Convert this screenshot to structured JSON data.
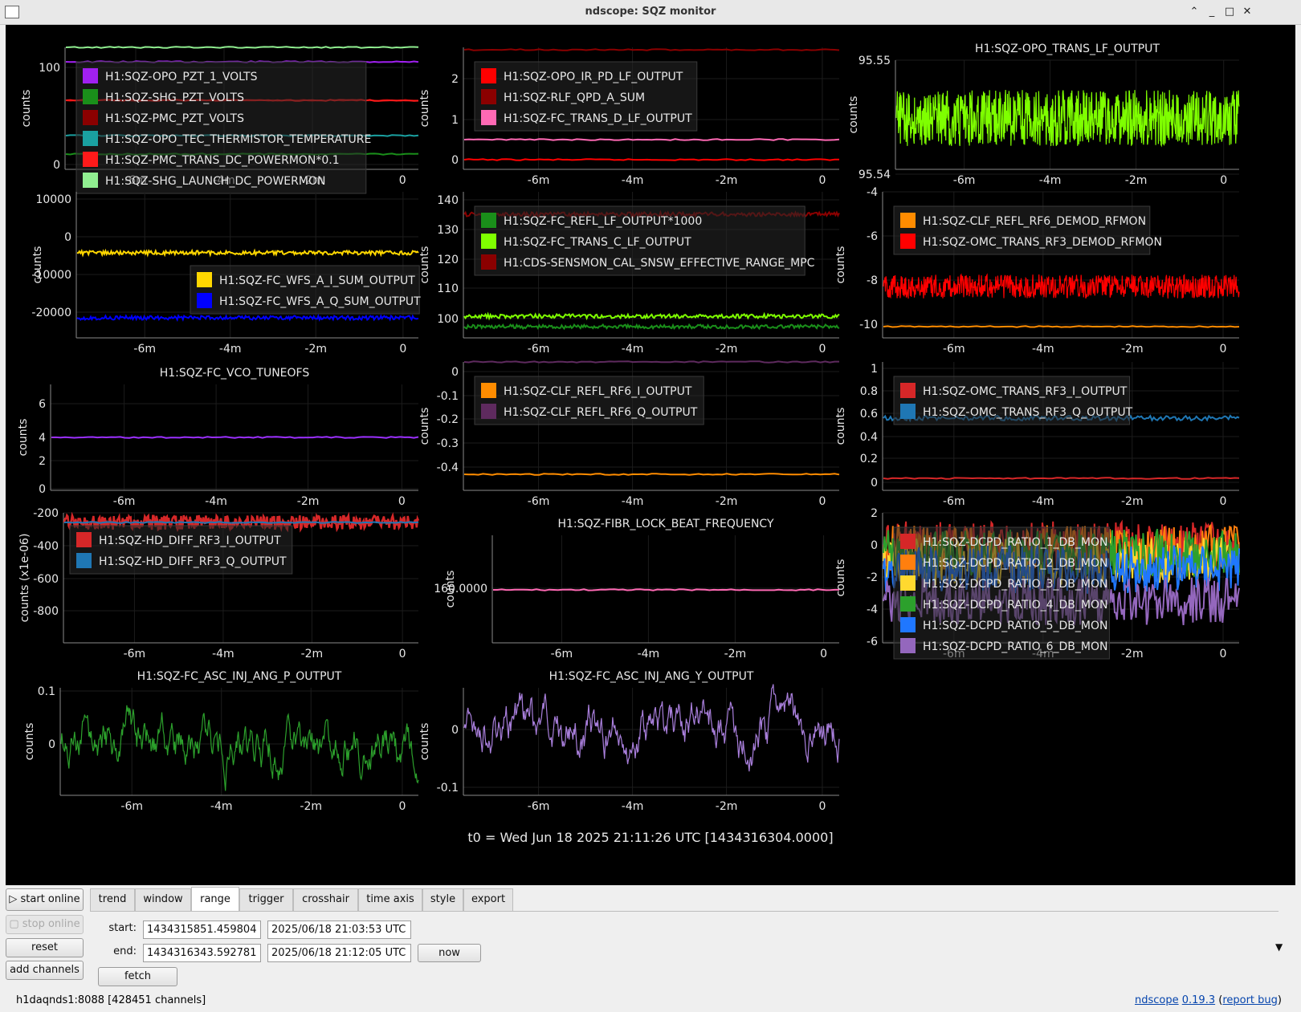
{
  "window": {
    "title": "ndscope: SQZ monitor",
    "controls": {
      "minimize_up": "⌃",
      "minimize": "_",
      "maximize": "□",
      "close": "✕"
    }
  },
  "plot_bg": "#000000",
  "t0_label": "t0 = Wed Jun 18 2025 21:11:26 UTC [1434316304.0000]",
  "chart_data": [
    {
      "type": "line",
      "title": "",
      "ylabel": "counts",
      "xticks": [
        "-6m",
        "-4m",
        "-2m",
        "0"
      ],
      "yticks": [
        "100",
        "0"
      ],
      "series": [
        {
          "name": "H1:SQZ-OPO_PZT_1_VOLTS",
          "color": "#a020f0",
          "y": 100
        },
        {
          "name": "H1:SQZ-SHG_PZT_VOLTS",
          "color": "#1a8f1a",
          "y": 10
        },
        {
          "name": "H1:SQZ-PMC_PZT_VOLTS",
          "color": "#8b0000",
          "y": 62
        },
        {
          "name": "H1:SQZ-OPO_TEC_THERMISTOR_TEMPERATURE",
          "color": "#1aa0a0",
          "y": 28
        },
        {
          "name": "H1:SQZ-PMC_TRANS_DC_POWERMON*0.1",
          "color": "#ff1a1a",
          "y": 62
        },
        {
          "name": "H1:SQZ-SHG_LAUNCH_DC_POWERMON",
          "color": "#90ee90",
          "y": 0
        }
      ]
    },
    {
      "type": "line",
      "title": "",
      "ylabel": "counts",
      "xticks": [
        "-6m",
        "-4m",
        "-2m",
        "0"
      ],
      "yticks": [
        "2",
        "1",
        "0"
      ],
      "series": [
        {
          "name": "H1:SQZ-OPO_IR_PD_LF_OUTPUT",
          "color": "#ff0000",
          "y": 0
        },
        {
          "name": "H1:SQZ-RLF_QPD_A_SUM",
          "color": "#8b0000",
          "y": 2.7
        },
        {
          "name": "H1:SQZ-FC_TRANS_D_LF_OUTPUT",
          "color": "#ff69b4",
          "y": 0.5
        }
      ]
    },
    {
      "type": "line",
      "title": "H1:SQZ-OPO_TRANS_LF_OUTPUT",
      "ylabel": "counts",
      "xticks": [
        "-6m",
        "-4m",
        "-2m",
        "0"
      ],
      "yticks": [
        "95.55",
        "95.54"
      ],
      "series": [
        {
          "name": "",
          "color": "#7fff00",
          "y": 95.545
        }
      ]
    },
    {
      "type": "line",
      "title": "",
      "ylabel": "counts",
      "xticks": [
        "-6m",
        "-4m",
        "-2m",
        "0"
      ],
      "yticks": [
        "10000",
        "0",
        "-10000",
        "-20000"
      ],
      "series": [
        {
          "name": "H1:SQZ-FC_WFS_A_I_SUM_OUTPUT",
          "color": "#ffd700",
          "y": 0
        },
        {
          "name": "H1:SQZ-FC_WFS_A_Q_SUM_OUTPUT",
          "color": "#0000ff",
          "y": -17500
        }
      ]
    },
    {
      "type": "line",
      "title": "",
      "ylabel": "counts",
      "xticks": [
        "-6m",
        "-4m",
        "-2m",
        "0"
      ],
      "yticks": [
        "140",
        "130",
        "120",
        "110",
        "100"
      ],
      "series": [
        {
          "name": "H1:SQZ-FC_REFL_LF_OUTPUT*1000",
          "color": "#1a8f1a",
          "y": 103
        },
        {
          "name": "H1:SQZ-FC_TRANS_C_LF_OUTPUT",
          "color": "#7fff00",
          "y": 106
        },
        {
          "name": "H1:CDS-SENSMON_CAL_SNSW_EFFECTIVE_RANGE_MPC",
          "color": "#8b0000",
          "y": 137
        }
      ]
    },
    {
      "type": "line",
      "title": "",
      "ylabel": "counts",
      "xticks": [
        "-6m",
        "-4m",
        "-2m",
        "0"
      ],
      "yticks": [
        "-4",
        "-6",
        "-8",
        "-10"
      ],
      "series": [
        {
          "name": "H1:SQZ-CLF_REFL_RF6_DEMOD_RFMON",
          "color": "#ff8c00",
          "y": -10.4
        },
        {
          "name": "H1:SQZ-OMC_TRANS_RF3_DEMOD_RFMON",
          "color": "#ff0000",
          "y": -8.5
        }
      ]
    },
    {
      "type": "line",
      "title": "H1:SQZ-FC_VCO_TUNEOFS",
      "ylabel": "counts",
      "xticks": [
        "-6m",
        "-4m",
        "-2m",
        "0"
      ],
      "yticks": [
        "6",
        "4",
        "2",
        "0"
      ],
      "series": [
        {
          "name": "",
          "color": "#9b30ff",
          "y": 3.6
        }
      ]
    },
    {
      "type": "line",
      "title": "",
      "ylabel": "counts",
      "xticks": [
        "-6m",
        "-4m",
        "-2m",
        "0"
      ],
      "yticks": [
        "0",
        "-0.1",
        "-0.2",
        "-0.3",
        "-0.4"
      ],
      "series": [
        {
          "name": "H1:SQZ-CLF_REFL_RF6_I_OUTPUT",
          "color": "#ff8c00",
          "y": -0.45
        },
        {
          "name": "H1:SQZ-CLF_REFL_RF6_Q_OUTPUT",
          "color": "#5e2a5e",
          "y": 0
        }
      ]
    },
    {
      "type": "line",
      "title": "",
      "ylabel": "counts",
      "xticks": [
        "-6m",
        "-4m",
        "-2m",
        "0"
      ],
      "yticks": [
        "1",
        "0.8",
        "0.6",
        "0.4",
        "0.2",
        "0"
      ],
      "series": [
        {
          "name": "H1:SQZ-OMC_TRANS_RF3_I_OUTPUT",
          "color": "#d62728",
          "y": 0.05
        },
        {
          "name": "H1:SQZ-OMC_TRANS_RF3_Q_OUTPUT",
          "color": "#1f77b4",
          "y": 0.62
        }
      ]
    },
    {
      "type": "line",
      "title": "",
      "ylabel": "counts (x1e-06)",
      "xticks": [
        "-6m",
        "-4m",
        "-2m",
        "0"
      ],
      "yticks": [
        "-200",
        "-400",
        "-600",
        "-800"
      ],
      "series": [
        {
          "name": "H1:SQZ-HD_DIFF_RF3_I_OUTPUT",
          "color": "#d62728",
          "y": -220
        },
        {
          "name": "H1:SQZ-HD_DIFF_RF3_Q_OUTPUT",
          "color": "#1f77b4",
          "y": -220
        }
      ]
    },
    {
      "type": "line",
      "title": "H1:SQZ-FIBR_LOCK_BEAT_FREQUENCY",
      "ylabel": "counts",
      "xticks": [
        "-6m",
        "-4m",
        "-2m",
        "0"
      ],
      "yticks": [
        "160.0000"
      ],
      "series": [
        {
          "name": "",
          "color": "#ff69b4",
          "y": 160
        }
      ]
    },
    {
      "type": "line",
      "title": "",
      "ylabel": "counts",
      "xticks": [
        "-6m",
        "-4m",
        "-2m",
        "0"
      ],
      "yticks": [
        "2",
        "0",
        "-2",
        "-4",
        "-6"
      ],
      "series": [
        {
          "name": "H1:SQZ-DCPD_RATIO_1_DB_MON",
          "color": "#d62728",
          "y": 1
        },
        {
          "name": "H1:SQZ-DCPD_RATIO_2_DB_MON",
          "color": "#ff7f0e",
          "y": 1.5
        },
        {
          "name": "H1:SQZ-DCPD_RATIO_3_DB_MON",
          "color": "#ffd92f",
          "y": -1
        },
        {
          "name": "H1:SQZ-DCPD_RATIO_4_DB_MON",
          "color": "#2ca02c",
          "y": 0
        },
        {
          "name": "H1:SQZ-DCPD_RATIO_5_DB_MON",
          "color": "#1f77ff",
          "y": -2
        },
        {
          "name": "H1:SQZ-DCPD_RATIO_6_DB_MON",
          "color": "#9467bd",
          "y": -3.5
        }
      ]
    },
    {
      "type": "line",
      "title": "H1:SQZ-FC_ASC_INJ_ANG_P_OUTPUT",
      "ylabel": "counts",
      "xticks": [
        "-6m",
        "-4m",
        "-2m",
        "0"
      ],
      "yticks": [
        "0.1",
        "0"
      ],
      "series": [
        {
          "name": "",
          "color": "#2ca02c",
          "y": 0
        }
      ]
    },
    {
      "type": "line",
      "title": "H1:SQZ-FC_ASC_INJ_ANG_Y_OUTPUT",
      "ylabel": "counts",
      "xticks": [
        "-6m",
        "-4m",
        "-2m",
        "0"
      ],
      "yticks": [
        "0",
        "-0.1"
      ],
      "series": [
        {
          "name": "",
          "color": "#a97fdc",
          "y": 0
        }
      ]
    }
  ],
  "tabs": [
    {
      "label": "trend"
    },
    {
      "label": "window"
    },
    {
      "label": "range"
    },
    {
      "label": "trigger"
    },
    {
      "label": "crosshair"
    },
    {
      "label": "time axis"
    },
    {
      "label": "style"
    },
    {
      "label": "export"
    }
  ],
  "active_tab": "range",
  "buttons": {
    "start_online": "▷ start online",
    "stop_online": "▢ stop online",
    "reset": "reset",
    "add_channels": "add channels",
    "fetch": "fetch",
    "now": "now"
  },
  "range": {
    "start_label": "start:",
    "end_label": "end:",
    "start_gps": "1434315851.459804",
    "start_utc": "2025/06/18 21:03:53 UTC",
    "end_gps": "1434316343.592781",
    "end_utc": "2025/06/18 21:12:05 UTC"
  },
  "status": {
    "server": "h1daqnds1:8088  [428451 channels]",
    "app_name": "ndscope",
    "version": "0.19.3",
    "report_pre": "(",
    "report_link": "report bug",
    "report_post": ")",
    "collapse_arrow": "▼"
  }
}
